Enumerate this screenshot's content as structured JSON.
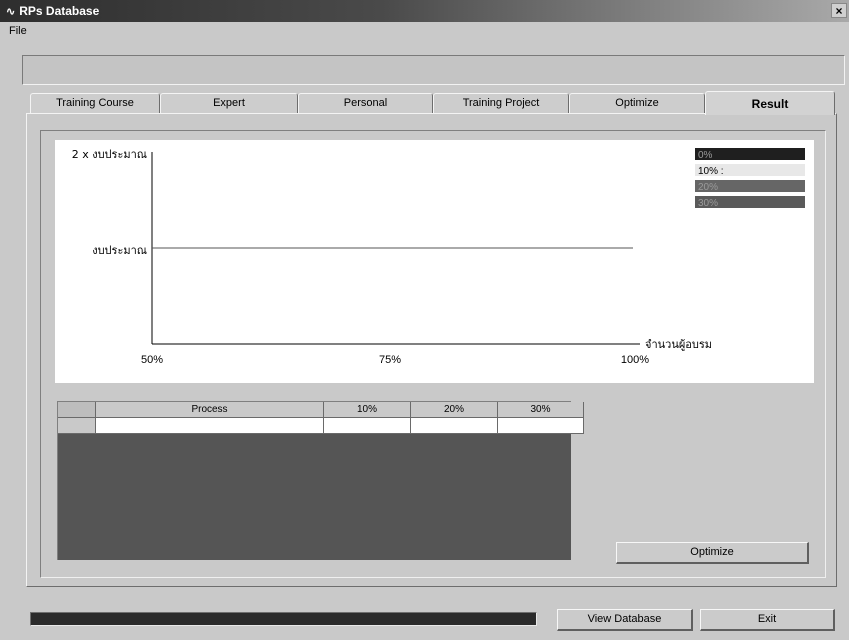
{
  "window": {
    "title": "RPs Database",
    "close_glyph": "×"
  },
  "menu": {
    "file": "File"
  },
  "tabs": [
    {
      "label": "Training Course",
      "active": false
    },
    {
      "label": "Expert",
      "active": false
    },
    {
      "label": "Personal",
      "active": false
    },
    {
      "label": "Training Project",
      "active": false
    },
    {
      "label": "Optimize",
      "active": false
    },
    {
      "label": "Result",
      "active": true
    }
  ],
  "chart_data": {
    "type": "line",
    "y_tick_labels": [
      "2 x งบประมาณ",
      "งบประมาณ"
    ],
    "x_tick_labels": [
      "50%",
      "75%",
      "100%"
    ],
    "xlabel": "จำนวนผู้อบรม",
    "reference_line": {
      "label": "งบประมาณ"
    },
    "legend": {
      "placement": "top-right",
      "items": [
        {
          "label": "0%",
          "color": "#1f1f1f"
        },
        {
          "label": "10% :",
          "color": "#e8e8e8"
        },
        {
          "label": "20%",
          "color": "#666666"
        },
        {
          "label": "30%",
          "color": "#5a5a5a"
        }
      ]
    },
    "series": []
  },
  "grid": {
    "columns": [
      "",
      "Process",
      "10%",
      "20%",
      "30%"
    ],
    "rows": [
      [
        "",
        "",
        "",
        "",
        ""
      ]
    ]
  },
  "buttons": {
    "optimize": "Optimize",
    "view_database": "View Database",
    "exit": "Exit"
  },
  "progress": {
    "value": 1.0
  },
  "icons": {
    "app": "app-icon",
    "close": "close-icon"
  },
  "colors": {
    "titlebar": "#2e2e2e",
    "face": "#c9c9c9",
    "grid_bg": "#555555"
  }
}
